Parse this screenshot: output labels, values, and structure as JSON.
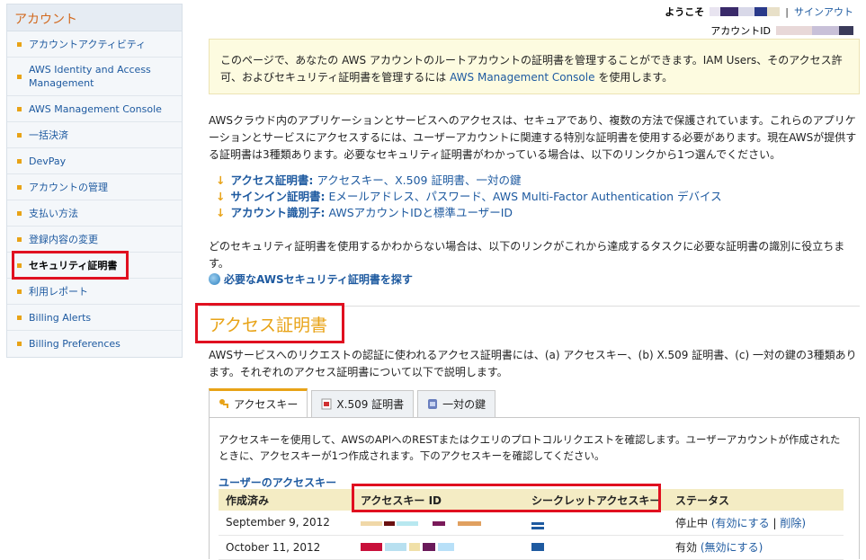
{
  "sidebar": {
    "title": "アカウント",
    "items": [
      {
        "label": "アカウントアクティビティ"
      },
      {
        "label": "AWS Identity and Access Management"
      },
      {
        "label": "AWS Management Console"
      },
      {
        "label": "一括決済"
      },
      {
        "label": "DevPay"
      },
      {
        "label": "アカウントの管理"
      },
      {
        "label": "支払い方法"
      },
      {
        "label": "登録内容の変更"
      },
      {
        "label": "セキュリティ証明書"
      },
      {
        "label": "利用レポート"
      },
      {
        "label": "Billing Alerts"
      },
      {
        "label": "Billing Preferences"
      }
    ]
  },
  "header": {
    "welcome": "ようこそ",
    "separator": "|",
    "signout": "サインアウト",
    "account_id_label": "アカウントID"
  },
  "info": {
    "text_before": "このページで、あなたの AWS アカウントのルートアカウントの証明書を管理することができます。IAM Users、そのアクセス許可、およびセキュリティ証明書を管理するには",
    "link": "AWS Management Console",
    "text_after": "を使用します。"
  },
  "intro": {
    "text": "AWSクラウド内のアプリケーションとサービスへのアクセスは、セキュアであり、複数の方法で保護されています。これらのアプリケーションとサービスにアクセスするには、ユーザーアカウントに関連する特別な証明書を使用する必要があります。現在AWSが提供する証明書は3種類あります。必要なセキュリティ証明書がわかっている場合は、以下のリンクから1つ選んでください。"
  },
  "cred_types": [
    {
      "label": "アクセス証明書:",
      "desc": "アクセスキー、X.509 証明書、一対の鍵"
    },
    {
      "label": "サインイン証明書:",
      "desc": "Eメールアドレス、パスワード、AWS Multi-Factor Authentication デバイス"
    },
    {
      "label": "アカウント識別子:",
      "desc": "AWSアカウントIDと標準ユーザーID"
    }
  ],
  "help_text": "どのセキュリティ証明書を使用するかわからない場合は、以下のリンクがこれから達成するタスクに必要な証明書の識別に役立ちます。",
  "find_link": "必要なAWSセキュリティ証明書を探す",
  "access": {
    "title": "アクセス証明書",
    "desc": "AWSサービスへのリクエストの認証に使われるアクセス証明書には、(a) アクセスキー、(b) X.509 証明書、(c) 一対の鍵の3種類あります。それぞれのアクセス証明書について以下で説明します。"
  },
  "tabs": [
    {
      "label": "アクセスキー"
    },
    {
      "label": "X.509 証明書"
    },
    {
      "label": "一対の鍵"
    }
  ],
  "panel": {
    "text": "アクセスキーを使用して、AWSのAPIへのRESTまたはクエリのプロトコルリクエストを確認します。ユーザーアカウントが作成されたときに、アクセスキーが1つ作成されます。下のアクセスキーを確認してください。",
    "heading": "ユーザーのアクセスキー"
  },
  "table": {
    "headers": [
      "作成済み",
      "アクセスキー ID",
      "シークレットアクセスキー",
      "ステータス"
    ],
    "rows": [
      {
        "created": "September 9, 2012",
        "status": "停止中",
        "actions": [
          "(有効にする",
          "|",
          "削除)"
        ]
      },
      {
        "created": "October 11, 2012",
        "status": "有効",
        "actions": [
          "(無効にする)"
        ]
      }
    ]
  },
  "colors": {
    "accent": "#e8a317",
    "link": "#1e5aa0",
    "highlight": "#e01020"
  }
}
